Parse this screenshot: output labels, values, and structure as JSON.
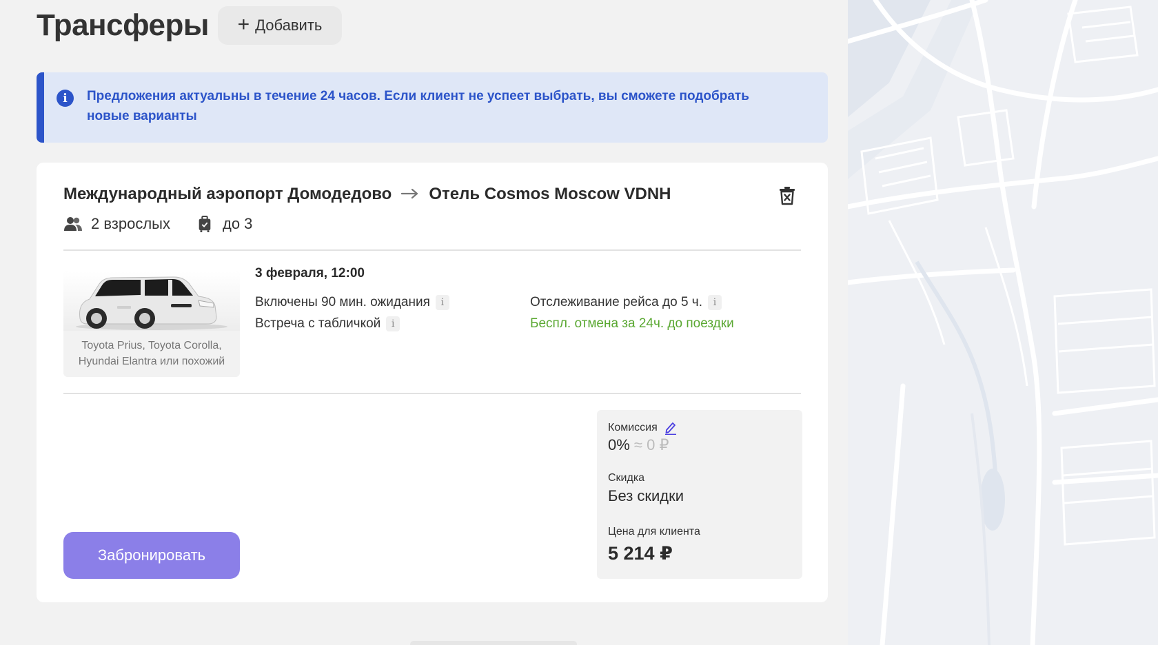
{
  "header": {
    "title": "Трансферы",
    "add_label": "Добавить"
  },
  "banner": {
    "text": "Предложения актуальны в течение 24 часов. Если клиент не успеет выбрать, вы сможете подобрать новые варианты"
  },
  "transfer": {
    "from": "Международный аэропорт Домодедово",
    "to": "Отель Cosmos Moscow VDNH",
    "passengers": "2 взрослых",
    "luggage": "до 3",
    "car_caption_line1": "Toyota Prius, Toyota Corolla,",
    "car_caption_line2": "Hyundai Elantra или похожий",
    "date": "3 февраля, 12:00",
    "features": {
      "waiting": "Включены 90 мин. ожидания",
      "sign": "Встреча с табличкой",
      "tracking": "Отслеживание рейса до 5 ч.",
      "cancel": "Беспл. отмена за 24ч. до поездки"
    },
    "info_glyph": "i"
  },
  "pricing": {
    "commission_label": "Комиссия",
    "commission_value": "0%",
    "commission_approx": "≈ 0 ₽",
    "discount_label": "Скидка",
    "discount_value": "Без скидки",
    "client_price_label": "Цена для клиента",
    "client_price": "5 214 ₽"
  },
  "actions": {
    "book_label": "Забронировать"
  },
  "colors": {
    "accent": "#8b7fe8",
    "info_blue": "#2c54c9",
    "info_bg": "#dfe7f7",
    "green": "#5aa832"
  }
}
